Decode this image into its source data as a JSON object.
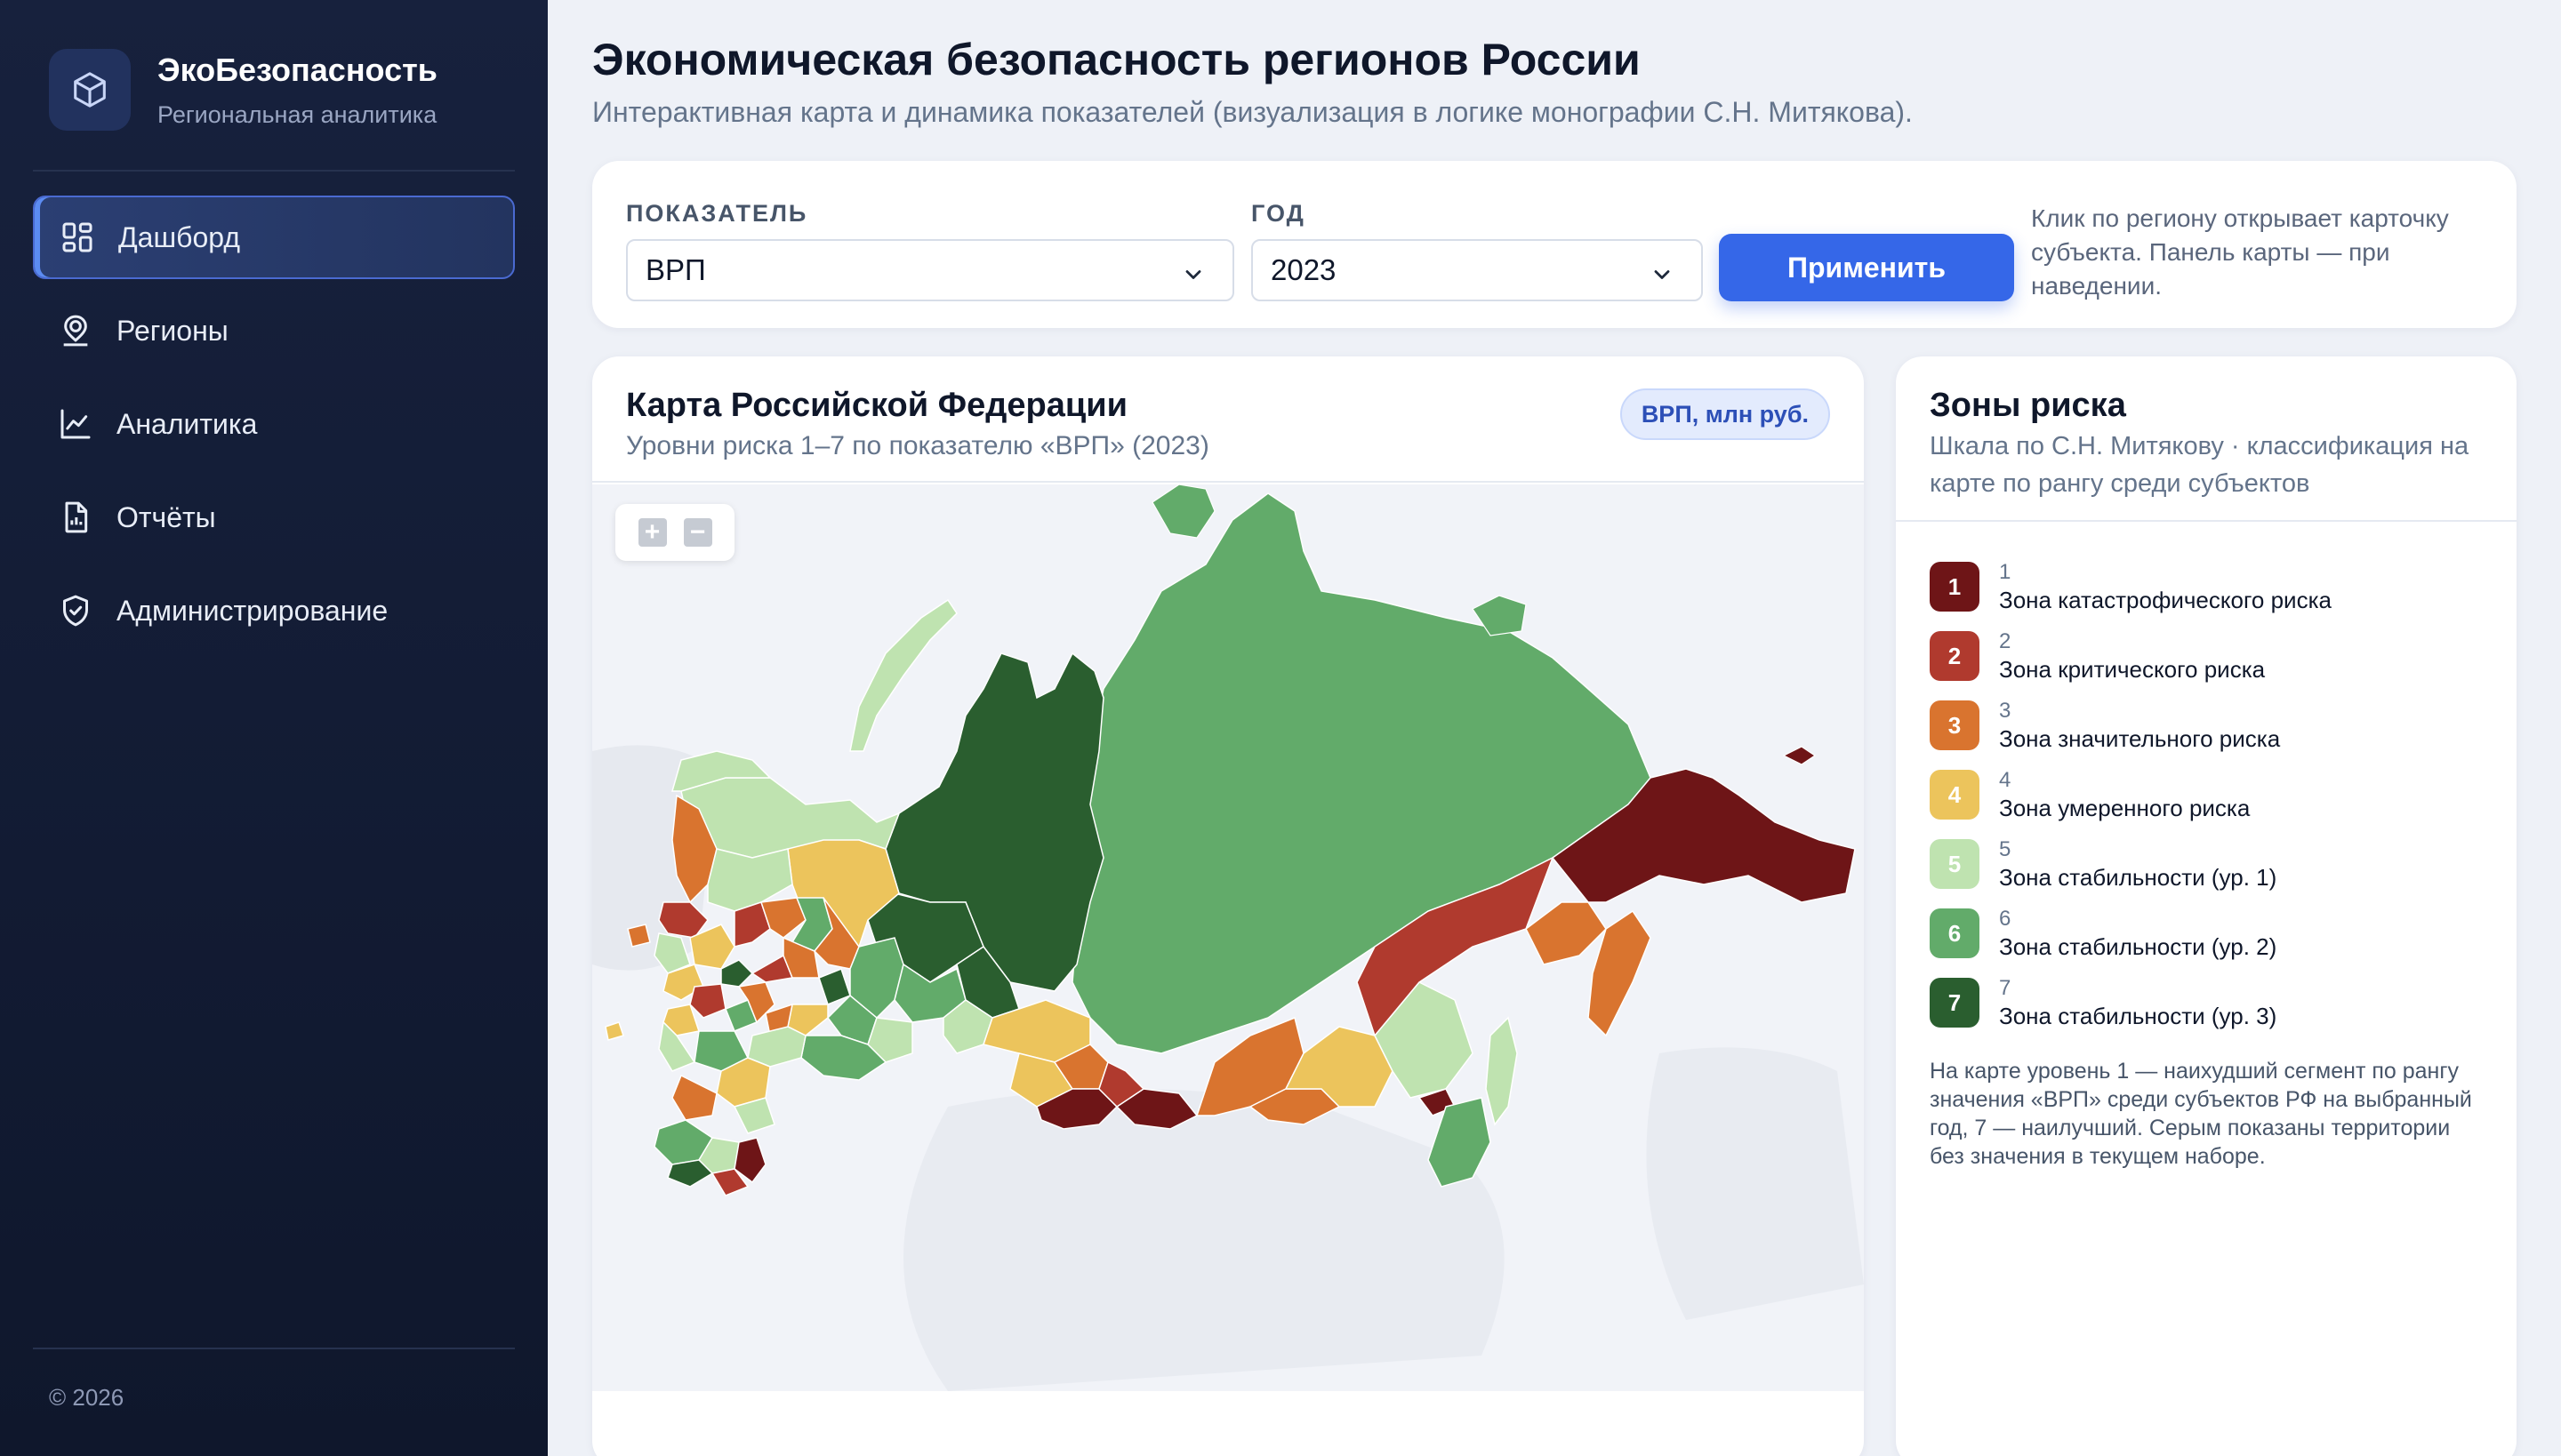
{
  "app": {
    "name": "ЭкоБезопасность",
    "subtitle": "Региональная аналитика"
  },
  "nav": {
    "items": [
      {
        "label": "Дашборд",
        "icon": "dashboard-icon",
        "active": true
      },
      {
        "label": "Регионы",
        "icon": "map-pin-icon",
        "active": false
      },
      {
        "label": "Аналитика",
        "icon": "chart-line-icon",
        "active": false
      },
      {
        "label": "Отчёты",
        "icon": "report-icon",
        "active": false
      },
      {
        "label": "Администрирование",
        "icon": "shield-icon",
        "active": false
      }
    ]
  },
  "footer": {
    "copyright": "© 2026"
  },
  "page": {
    "title": "Экономическая безопасность регионов России",
    "subtitle": "Интерактивная карта и динамика показателей (визуализация в логике монографии С.Н. Митякова)."
  },
  "filters": {
    "indicator_label": "ПОКАЗАТЕЛЬ",
    "indicator_value": "ВРП",
    "year_label": "ГОД",
    "year_value": "2023",
    "apply_label": "Применить",
    "hint": "Клик по региону открывает карточку субъекта. Панель карты — при наведении."
  },
  "map": {
    "title": "Карта Российской Федерации",
    "subtitle": "Уровни риска 1–7 по показателю «ВРП» (2023)",
    "unit_badge": "ВРП, млн руб.",
    "zoom_in": "+",
    "zoom_out": "−"
  },
  "legend": {
    "title": "Зоны риска",
    "subtitle": "Шкала по С.Н. Митякову · классификация на карте по рангу среди субъектов",
    "zones": [
      {
        "level": "1",
        "name": "Зона катастрофического риска",
        "color": "#6e1517"
      },
      {
        "level": "2",
        "name": "Зона критического риска",
        "color": "#b03a2e"
      },
      {
        "level": "3",
        "name": "Зона значительного риска",
        "color": "#d9742f"
      },
      {
        "level": "4",
        "name": "Зона умеренного риска",
        "color": "#ecc45c"
      },
      {
        "level": "5",
        "name": "Зона стабильности (ур. 1)",
        "color": "#bfe3b0"
      },
      {
        "level": "6",
        "name": "Зона стабильности (ур. 2)",
        "color": "#62ab6a"
      },
      {
        "level": "7",
        "name": "Зона стабильности (ур. 3)",
        "color": "#2a5e2f"
      }
    ],
    "note": "На карте уровень 1 — наихудший сегмент по рангу значения «ВРП» среди субъектов РФ на выбранный год, 7 — наилучший. Серым показаны территории без значения в текущем наборе."
  }
}
